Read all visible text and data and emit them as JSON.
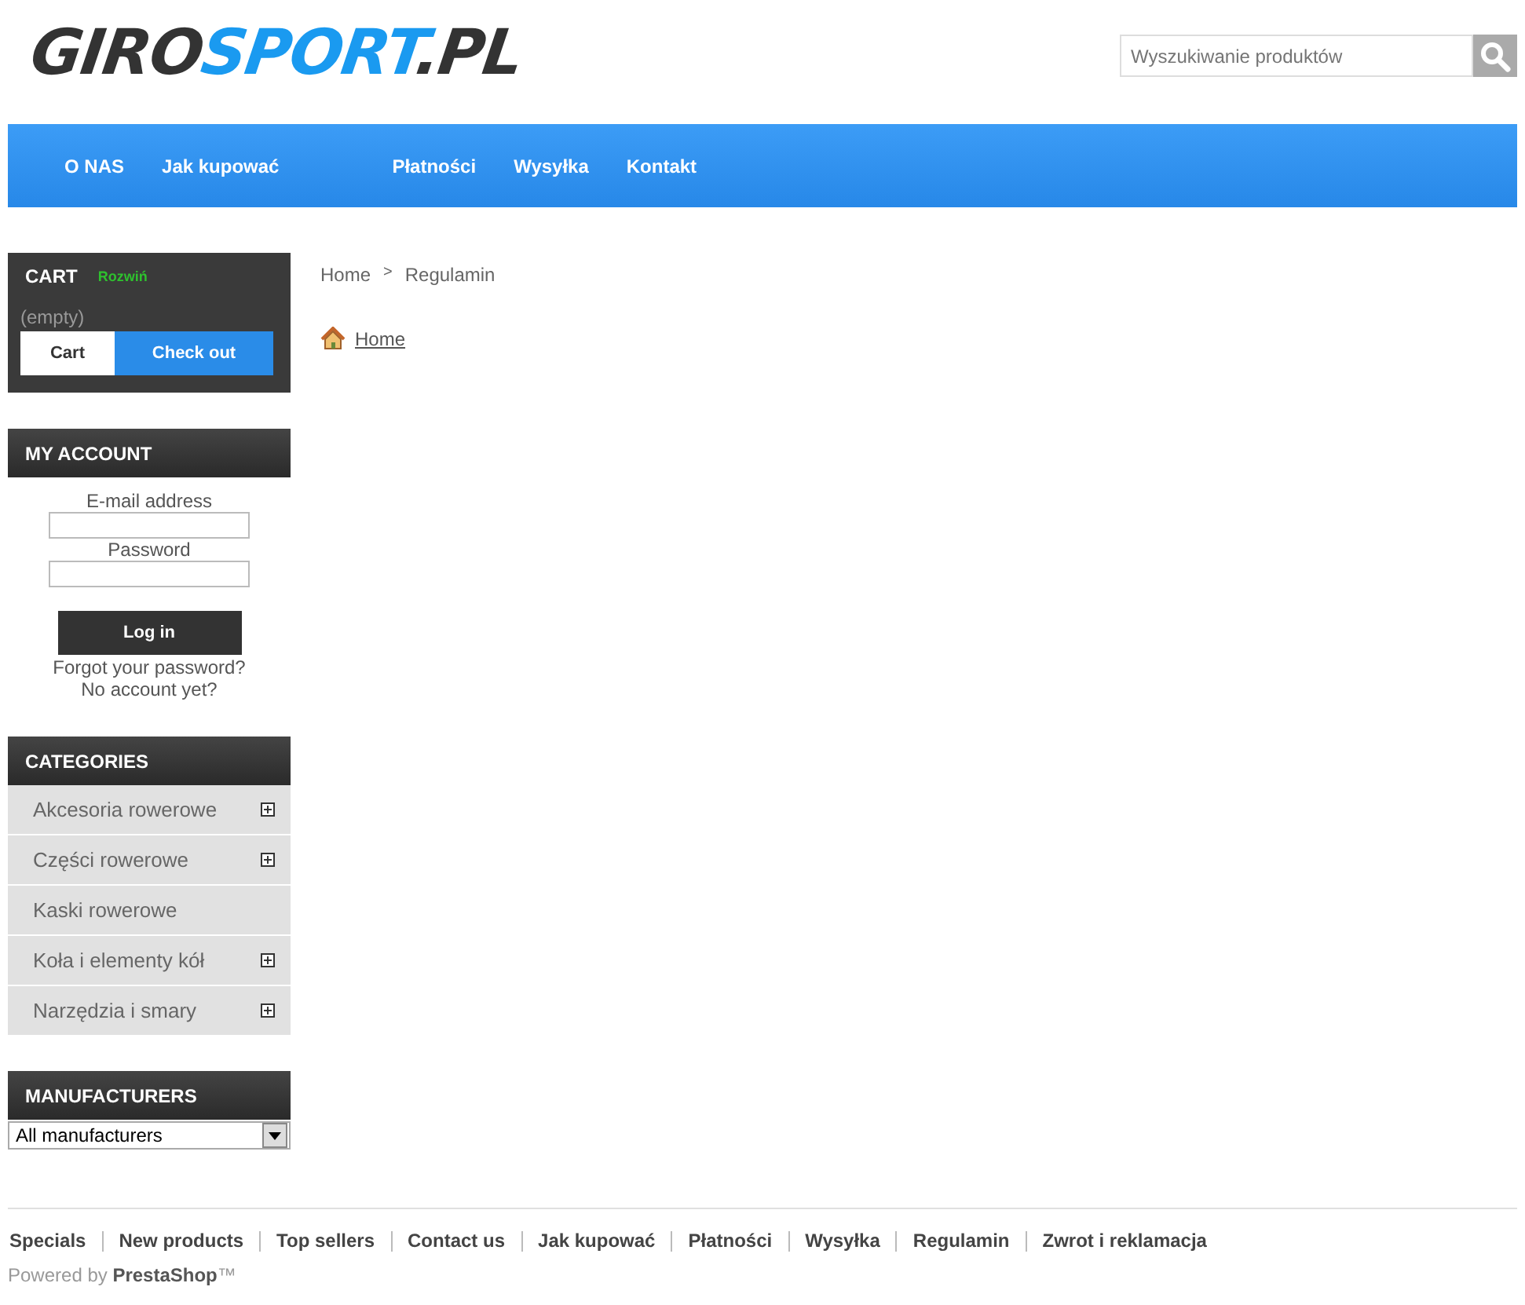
{
  "logo": {
    "parts": [
      "GIRO",
      "SPORT",
      ".PL"
    ]
  },
  "search": {
    "placeholder": "Wyszukiwanie produktów"
  },
  "nav": [
    "O NAS",
    "Jak kupować",
    "Płatności",
    "Wysyłka",
    "Kontakt"
  ],
  "cart": {
    "title": "CART",
    "toggle": "Rozwiń",
    "status": "(empty)",
    "buttons": [
      "Cart",
      "Check out"
    ]
  },
  "account": {
    "title": "MY ACCOUNT",
    "email_label": "E-mail address",
    "password_label": "Password",
    "login": "Log in",
    "links": [
      "Forgot your password?",
      "No account yet?"
    ]
  },
  "categories": {
    "title": "CATEGORIES",
    "items": [
      {
        "label": "Akcesoria rowerowe",
        "expandable": true
      },
      {
        "label": "Części rowerowe",
        "expandable": true
      },
      {
        "label": "Kaski rowerowe",
        "expandable": false
      },
      {
        "label": "Koła i elementy kół",
        "expandable": true
      },
      {
        "label": "Narzędzia i smary",
        "expandable": true
      }
    ]
  },
  "manufacturers": {
    "title": "MANUFACTURERS",
    "select": "All manufacturers"
  },
  "breadcrumb": [
    "Home",
    "Regulamin"
  ],
  "breadcrumb_separator": ">",
  "home_link": "Home",
  "footer": {
    "links": [
      "Specials",
      "New products",
      "Top sellers",
      "Contact us",
      "Jak kupować",
      "Płatności",
      "Wysyłka",
      "Regulamin",
      "Zwrot i reklamacja"
    ],
    "powered": "Powered by **PrestaShop**™"
  }
}
